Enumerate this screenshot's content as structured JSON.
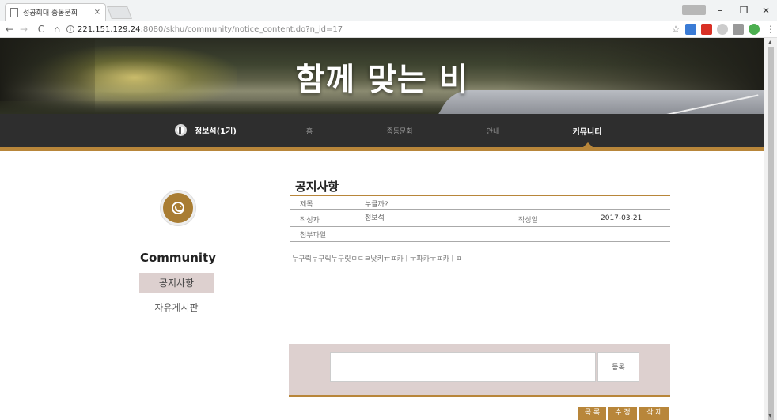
{
  "browser": {
    "tab_title": "성공회대 종동문회",
    "tab_close": "×",
    "url_host": "221.151.129.24",
    "url_rest": ":8080/skhu/community/notice_content.do?n_id=17",
    "window_minimize": "–",
    "window_restore": "❐",
    "window_close": "×",
    "back": "←",
    "forward": "→",
    "reload": "C",
    "home": "⌂",
    "star": "☆",
    "menu": "⋮"
  },
  "hero": {
    "title": "함께 맞는 비"
  },
  "nav": {
    "user_name": "정보석(1기)",
    "items": [
      {
        "label": "홈"
      },
      {
        "label": "종동문회"
      },
      {
        "label": "안내"
      },
      {
        "label": "커뮤니티"
      }
    ]
  },
  "sidebar": {
    "title": "Community",
    "links": [
      {
        "label": "공지사항"
      },
      {
        "label": "자유게시판"
      }
    ]
  },
  "board": {
    "title": "공지사항",
    "subject_label": "제목",
    "subject": "누글까?",
    "author_label": "작성자",
    "author": "정보석",
    "date_label": "작성일",
    "date": "2017-03-21",
    "attachment_label": "첨부파일",
    "body": "누구릭누구릭누구릿ㅁㄷㄹ낮키ㅠㅍ카ㅣㅜ파카ㅜㅍ카ㅣㅍ"
  },
  "comment": {
    "submit_label": "등록"
  },
  "actions": {
    "list": "목 록",
    "edit": "수 정",
    "delete": "삭 제"
  },
  "colors": {
    "accent": "#b8863a",
    "nav_bg": "#2e2e2e",
    "sidebar_active_bg": "#ddd0cf"
  },
  "icons": {
    "page": "page-icon",
    "avatar": "user-avatar-icon",
    "smiley": "smiley-icon",
    "info": "info-icon"
  }
}
